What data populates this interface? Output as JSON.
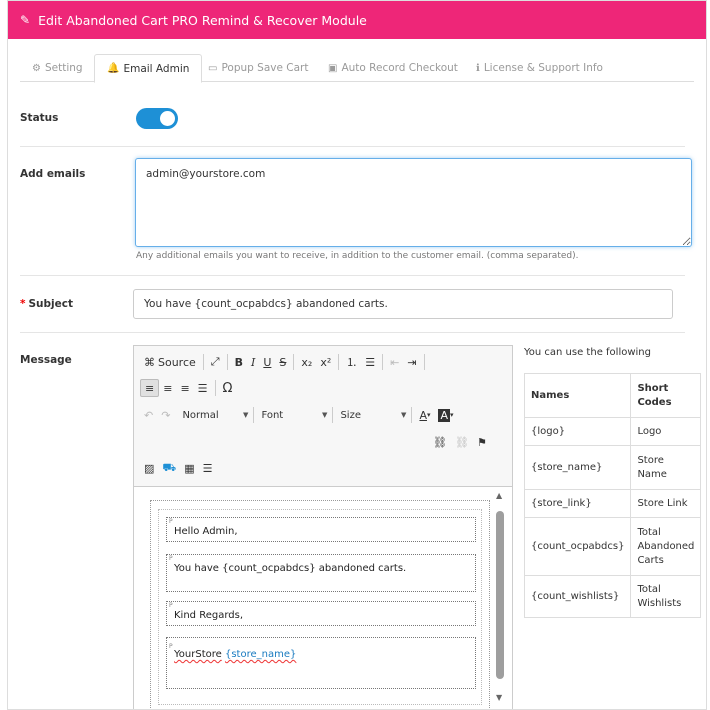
{
  "header": {
    "title": "Edit Abandoned Cart PRO Remind & Recover Module",
    "accent_color": "#ee2678"
  },
  "tabs": [
    {
      "label": "Setting",
      "icon": "gear-icon",
      "active": false
    },
    {
      "label": "Email Admin",
      "icon": "bell-icon",
      "active": true
    },
    {
      "label": "Popup Save Cart",
      "icon": "monitor-icon",
      "active": false
    },
    {
      "label": "Auto Record Checkout",
      "icon": "save-icon",
      "active": false
    },
    {
      "label": "License & Support Info",
      "icon": "info-icon",
      "active": false
    }
  ],
  "status": {
    "label": "Status",
    "enabled": true,
    "toggle_color": "#1e90d6"
  },
  "emails": {
    "label": "Add emails",
    "value": "admin@yourstore.com",
    "help": "Any additional emails you want to receive, in addition to the customer email. (comma separated)."
  },
  "subject": {
    "required_mark": "*",
    "label": "Subject",
    "value": "You have {count_ocpabdcs} abandoned carts."
  },
  "message": {
    "label": "Message",
    "toolbar": {
      "source_label": "Source",
      "format_value": "Normal",
      "font_value": "Font",
      "size_value": "Size",
      "omega": "Ω"
    },
    "paragraph_marker": "P",
    "lines": [
      "Hello Admin,",
      "You have {count_ocpabdcs} abandoned carts.",
      "Kind Regards,",
      "YourStore",
      "{store_name}"
    ]
  },
  "shortcodes": {
    "intro": "You can use the following",
    "headers": [
      "Names",
      "Short Codes"
    ],
    "rows": [
      [
        "{logo}",
        "Logo"
      ],
      [
        "{store_name}",
        "Store Name"
      ],
      [
        "{store_link}",
        "Store Link"
      ],
      [
        "{count_ocpabdcs}",
        "Total Abandoned Carts"
      ],
      [
        "{count_wishlists}",
        "Total Wishlists"
      ]
    ]
  }
}
